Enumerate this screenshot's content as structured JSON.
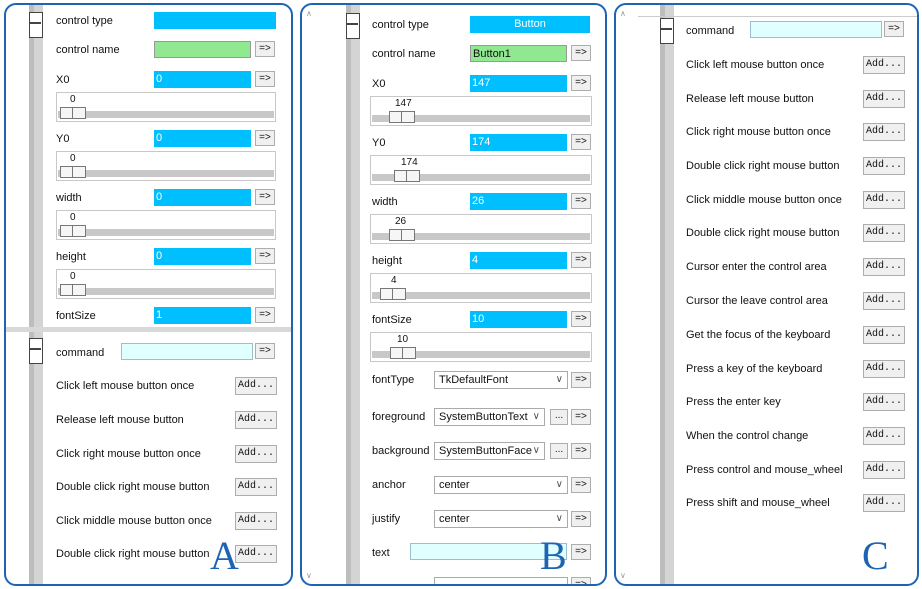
{
  "panel_a": {
    "letter": "A",
    "props": [
      {
        "label": "control type",
        "value": "",
        "style": "blue"
      },
      {
        "label": "control name",
        "value": "",
        "style": "green"
      },
      {
        "label": "X0",
        "value": "0",
        "style": "blue",
        "slider": "0"
      },
      {
        "label": "Y0",
        "value": "0",
        "style": "blue",
        "slider": "0"
      },
      {
        "label": "width",
        "value": "0",
        "style": "blue",
        "slider": "0"
      },
      {
        "label": "height",
        "value": "0",
        "style": "blue",
        "slider": "0"
      },
      {
        "label": "fontSize",
        "value": "1",
        "style": "blue"
      }
    ],
    "command_label": "command",
    "command_value": "",
    "events": [
      "Click left mouse button once",
      "Release left mouse button",
      "Click right mouse button once",
      "Double click right mouse button",
      "Click middle mouse button once",
      "Double click right mouse button"
    ],
    "add_label": "Add...",
    "arrow_label": "=>"
  },
  "panel_b": {
    "letter": "B",
    "control_type_label": "control type",
    "control_type_value": "Button",
    "control_name_label": "control name",
    "control_name_value": "Button1",
    "sliders": [
      {
        "label": "X0",
        "value": "147",
        "slider": "147",
        "pos": 0.08
      },
      {
        "label": "Y0",
        "value": "174",
        "slider": "174",
        "pos": 0.08
      },
      {
        "label": "width",
        "value": "26",
        "slider": "26",
        "pos": 0.08
      },
      {
        "label": "height",
        "value": "4",
        "slider": "4",
        "pos": 0.02
      },
      {
        "label": "fontSize",
        "value": "10",
        "slider": "10",
        "pos": 0.02
      }
    ],
    "combos": [
      {
        "label": "fontType",
        "value": "TkDefaultFont",
        "dots": false
      },
      {
        "label": "foreground",
        "value": "SystemButtonText",
        "dots": true
      },
      {
        "label": "background",
        "value": "SystemButtonFace",
        "dots": true
      },
      {
        "label": "anchor",
        "value": "center",
        "dots": false
      },
      {
        "label": "justify",
        "value": "center",
        "dots": false
      }
    ],
    "text_label": "text",
    "text_value": "",
    "arrow_label": "=>",
    "dots_label": "..."
  },
  "panel_c": {
    "letter": "C",
    "command_label": "command",
    "command_value": "",
    "events": [
      "Click left mouse button once",
      "Release left mouse button",
      "Click right mouse button once",
      "Double click right mouse button",
      "Click middle mouse button once",
      "Double click right mouse button",
      "Cursor enter the control area",
      "Cursor the leave control area",
      "Get the focus of the keyboard",
      "Press a key of the keyboard",
      "Press the enter key",
      "When the control change",
      "Press control and mouse_wheel",
      "Press shift and mouse_wheel"
    ],
    "add_label": "Add...",
    "arrow_label": "=>"
  },
  "colors": {
    "frame": "#1e64b4",
    "field_blue": "#00bfff",
    "field_green": "#90e890",
    "field_lightcyan": "#e0ffff",
    "rail": "#d4d4d4"
  },
  "icons": {
    "arrow": "arrow-button-icon",
    "chevron": "chevron-down-icon",
    "control": "control-widget-icon"
  }
}
